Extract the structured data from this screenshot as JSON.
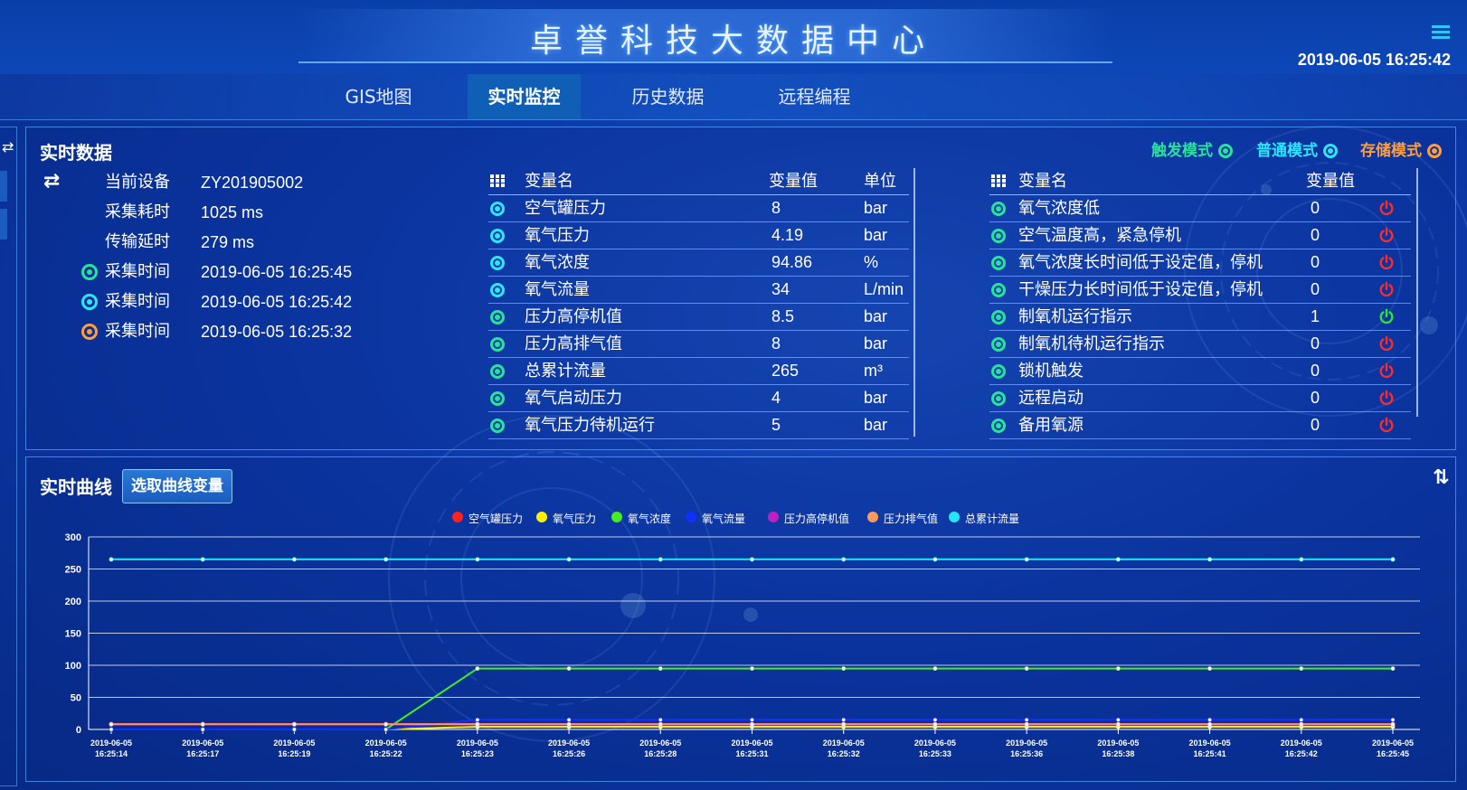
{
  "header": {
    "title": "卓誉科技大数据中心",
    "clock": "2019-06-05 16:25:42"
  },
  "nav": {
    "tabs": [
      {
        "label": "GIS地图"
      },
      {
        "label": "实时监控"
      },
      {
        "label": "历史数据"
      },
      {
        "label": "远程编程"
      }
    ],
    "active": "实时监控"
  },
  "realtime": {
    "title": "实时数据",
    "modes": [
      {
        "label": "触发模式",
        "color": "#27e39b"
      },
      {
        "label": "普通模式",
        "color": "#2ee6ff"
      },
      {
        "label": "存储模式",
        "color": "#ff9d3a"
      }
    ],
    "info": {
      "device_label": "当前设备",
      "device_value": "ZY201905002",
      "cost_label": "采集耗时",
      "cost_value": "1025 ms",
      "delay_label": "传输延时",
      "delay_value": "279 ms",
      "times": [
        {
          "label": "采集时间",
          "value": "2019-06-05 16:25:45",
          "color": "#27e39b"
        },
        {
          "label": "采集时间",
          "value": "2019-06-05 16:25:42",
          "color": "#2ee6ff"
        },
        {
          "label": "采集时间",
          "value": "2019-06-05 16:25:32",
          "color": "#ff9d3a"
        }
      ]
    },
    "table1": {
      "headers": {
        "name": "变量名",
        "value": "变量值",
        "unit": "单位"
      },
      "rows": [
        {
          "name": "空气罐压力",
          "value": "8",
          "unit": "bar",
          "mode": "cyan"
        },
        {
          "name": "氧气压力",
          "value": "4.19",
          "unit": "bar",
          "mode": "cyan"
        },
        {
          "name": "氧气浓度",
          "value": "94.86",
          "unit": "%",
          "mode": "cyan"
        },
        {
          "name": "氧气流量",
          "value": "34",
          "unit": "L/min",
          "mode": "cyan"
        },
        {
          "name": "压力高停机值",
          "value": "8.5",
          "unit": "bar",
          "mode": "green"
        },
        {
          "name": "压力高排气值",
          "value": "8",
          "unit": "bar",
          "mode": "green"
        },
        {
          "name": "总累计流量",
          "value": "265",
          "unit": "m³",
          "mode": "green"
        },
        {
          "name": "氧气启动压力",
          "value": "4",
          "unit": "bar",
          "mode": "green"
        },
        {
          "name": "氧气压力待机运行",
          "value": "5",
          "unit": "bar",
          "mode": "green"
        }
      ]
    },
    "table2": {
      "headers": {
        "name": "变量名",
        "value": "变量值"
      },
      "rows": [
        {
          "name": "氧气浓度低",
          "value": "0",
          "state": "off"
        },
        {
          "name": "空气温度高，紧急停机",
          "value": "0",
          "state": "off"
        },
        {
          "name": "氧气浓度长时间低于设定值，停机",
          "value": "0",
          "state": "off"
        },
        {
          "name": "干燥压力长时间低于设定值，停机",
          "value": "0",
          "state": "off"
        },
        {
          "name": "制氧机运行指示",
          "value": "1",
          "state": "on"
        },
        {
          "name": "制氧机待机运行指示",
          "value": "0",
          "state": "off"
        },
        {
          "name": "锁机触发",
          "value": "0",
          "state": "off"
        },
        {
          "name": "远程启动",
          "value": "0",
          "state": "off"
        },
        {
          "name": "备用氧源",
          "value": "0",
          "state": "off"
        }
      ]
    }
  },
  "curve": {
    "title": "实时曲线",
    "select_button": "选取曲线变量"
  },
  "chart_data": {
    "type": "line",
    "ylim": [
      0,
      300
    ],
    "yticks": [
      "300",
      "250",
      "200",
      "150",
      "100",
      "50",
      "0"
    ],
    "grid": true,
    "legend_position": "top",
    "x_labels": [
      [
        "2019-06-05",
        "16:25:14"
      ],
      [
        "2019-06-05",
        "16:25:17"
      ],
      [
        "2019-06-05",
        "16:25:19"
      ],
      [
        "2019-06-05",
        "16:25:22"
      ],
      [
        "2019-06-05",
        "16:25:23"
      ],
      [
        "2019-06-05",
        "16:25:26"
      ],
      [
        "2019-06-05",
        "16:25:28"
      ],
      [
        "2019-06-05",
        "16:25:31"
      ],
      [
        "2019-06-05",
        "16:25:32"
      ],
      [
        "2019-06-05",
        "16:25:33"
      ],
      [
        "2019-06-05",
        "16:25:36"
      ],
      [
        "2019-06-05",
        "16:25:38"
      ],
      [
        "2019-06-05",
        "16:25:41"
      ],
      [
        "2019-06-05",
        "16:25:42"
      ],
      [
        "2019-06-05",
        "16:25:45"
      ]
    ],
    "series": [
      {
        "name": "空气罐压力",
        "color": "#ff2020",
        "values": [
          8,
          8,
          8,
          8,
          8,
          8,
          8,
          8,
          8,
          8,
          8,
          8,
          8,
          8,
          8
        ]
      },
      {
        "name": "氧气压力",
        "color": "#ffee00",
        "values": [
          0,
          0,
          0,
          0,
          4.19,
          4.19,
          4.19,
          4.19,
          4.19,
          4.19,
          4.19,
          4.19,
          4.19,
          4.19,
          4.19
        ]
      },
      {
        "name": "氧气浓度",
        "color": "#44ee22",
        "values": [
          0,
          0,
          0,
          0,
          94.86,
          94.86,
          94.86,
          94.86,
          94.86,
          94.86,
          94.86,
          94.86,
          94.86,
          94.86,
          94.86
        ]
      },
      {
        "name": "氧气流量",
        "color": "#1030ff",
        "values": [
          0,
          0,
          0,
          0,
          15,
          15,
          15,
          15,
          15,
          15,
          15,
          15,
          15,
          15,
          15
        ]
      },
      {
        "name": "压力高停机值",
        "color": "#c020c0",
        "values": [
          8.5,
          8.5,
          8.5,
          8.5,
          8.5,
          8.5,
          8.5,
          8.5,
          8.5,
          8.5,
          8.5,
          8.5,
          8.5,
          8.5,
          8.5
        ]
      },
      {
        "name": "压力排气值",
        "color": "#ff9a5a",
        "values": [
          8,
          8,
          8,
          8,
          8,
          8,
          8,
          8,
          8,
          8,
          8,
          8,
          8,
          8,
          8
        ]
      },
      {
        "name": "总累计流量",
        "color": "#22e6f6",
        "values": [
          265,
          265,
          265,
          265,
          265,
          265,
          265,
          265,
          265,
          265,
          265,
          265,
          265,
          265,
          265
        ]
      }
    ]
  }
}
